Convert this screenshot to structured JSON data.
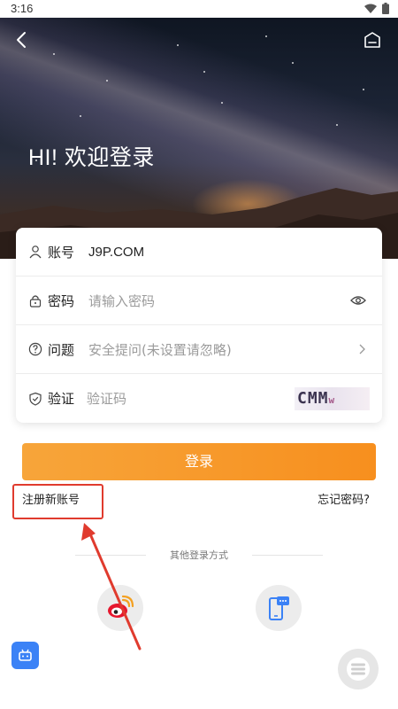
{
  "status": {
    "time": "3:16"
  },
  "hero": {
    "title": "HI! 欢迎登录"
  },
  "form": {
    "account": {
      "label": "账号",
      "value": "J9P.COM"
    },
    "password": {
      "label": "密码",
      "placeholder": "请输入密码"
    },
    "question": {
      "label": "问题",
      "placeholder": "安全提问(未设置请忽略)"
    },
    "captcha": {
      "label": "验证",
      "placeholder": "验证码",
      "image_text": "CMM",
      "image_small": "w"
    }
  },
  "actions": {
    "login_label": "登录",
    "register_label": "注册新账号",
    "forgot_label": "忘记密码?"
  },
  "other_login": {
    "title": "其他登录方式"
  },
  "colors": {
    "accent": "#f7931e",
    "highlight": "#e03b2e",
    "bot": "#3b82f6"
  },
  "icons": [
    "back-icon",
    "customer-service-icon",
    "user-icon",
    "lock-icon",
    "question-icon",
    "shield-icon",
    "eye-icon",
    "chevron-right-icon",
    "weibo-icon",
    "phone-chat-icon",
    "bot-icon",
    "menu-icon",
    "wifi-icon",
    "battery-icon"
  ]
}
